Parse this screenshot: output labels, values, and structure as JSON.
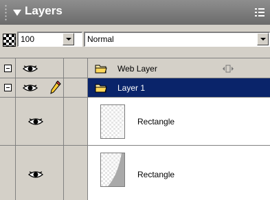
{
  "panel": {
    "title": "Layers",
    "colors": {
      "titlebar": "#7a7a7a",
      "selection": "#0a246a",
      "panel": "#d4d0c8"
    }
  },
  "options": {
    "opacity_value": "100",
    "blend_mode": "Normal"
  },
  "layers": [
    {
      "name": "Web Layer",
      "type": "folder",
      "expanded": true,
      "visible": true,
      "selected": false,
      "locked": true
    },
    {
      "name": "Layer 1",
      "type": "folder",
      "expanded": true,
      "visible": true,
      "selected": true,
      "active_edit": true
    },
    {
      "name": "Rectangle",
      "type": "object",
      "visible": true
    },
    {
      "name": "Rectangle",
      "type": "object",
      "visible": true
    }
  ]
}
